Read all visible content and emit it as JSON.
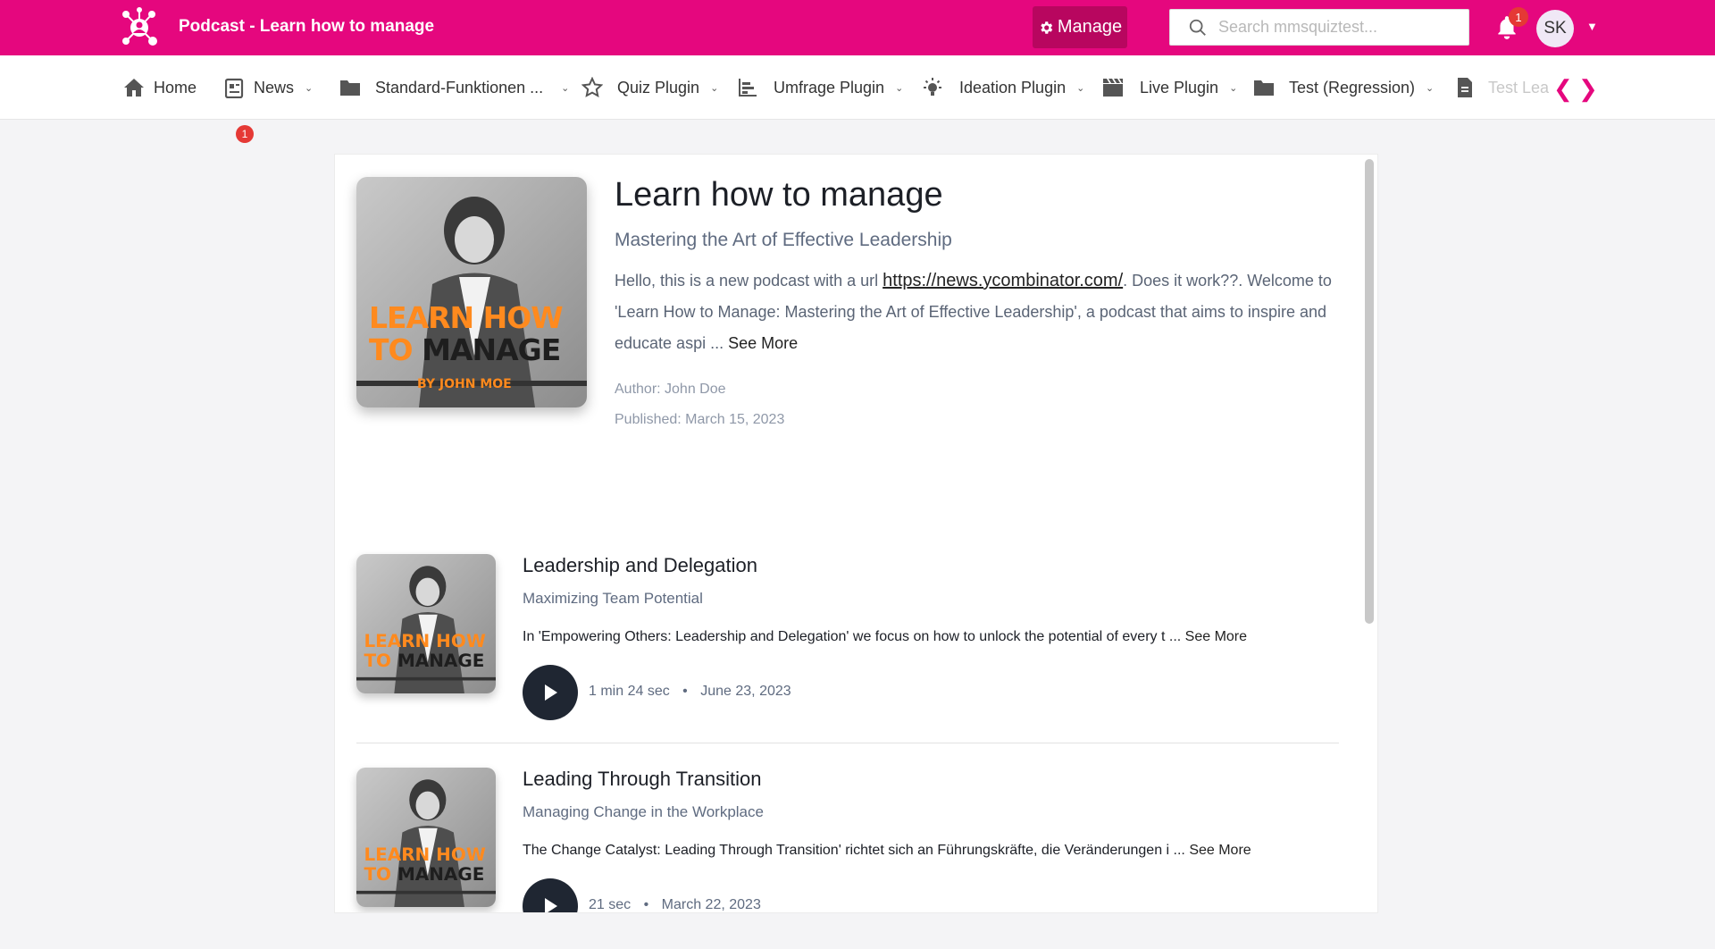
{
  "header": {
    "app_title": "Podcast - Learn how to manage",
    "manage_label": "Manage",
    "search_placeholder": "Search mmsquiztest...",
    "notifications_count": "1",
    "avatar_initials": "SK",
    "brand_color": "#e5077e"
  },
  "nav": {
    "items": [
      {
        "label": "Home",
        "icon": "home-icon"
      },
      {
        "label": "News",
        "icon": "news-icon",
        "badge": "1"
      },
      {
        "label": "Standard-Funktionen ...",
        "icon": "folder-icon"
      },
      {
        "label": "Quiz Plugin",
        "icon": "star-icon"
      },
      {
        "label": "Umfrage Plugin",
        "icon": "bar-chart-icon"
      },
      {
        "label": "Ideation Plugin",
        "icon": "lightbulb-icon"
      },
      {
        "label": "Live Plugin",
        "icon": "clapperboard-icon"
      },
      {
        "label": "Test (Regression)",
        "icon": "folder-icon"
      },
      {
        "label": "Test Lea",
        "icon": "document-icon"
      }
    ]
  },
  "podcast": {
    "cover_text_line1": "LEARN HOW",
    "cover_text_line2a": "TO",
    "cover_text_line2b": "MANAGE",
    "cover_byline": "BY JOHN MOE",
    "title": "Learn how to manage",
    "subtitle": "Mastering the Art of Effective Leadership",
    "description_before_link": "Hello, this is a new podcast with a url ",
    "description_link": "https://news.ycombinator.com/",
    "description_after_link": ". Does it work??. Welcome to 'Learn How to Manage: Mastering the Art of Effective Leadership', a podcast that aims to inspire and educate aspi ... ",
    "see_more": "See More",
    "author": "Author: John Doe",
    "published": "Published: March 15, 2023"
  },
  "episodes": [
    {
      "title": "Leadership and Delegation",
      "subtitle": "Maximizing Team Potential",
      "description": "In 'Empowering Others: Leadership and Delegation' we focus on how to unlock the potential of every t ... ",
      "see_more": "See More",
      "duration": "1 min 24 sec",
      "separator": "•",
      "date": "June 23, 2023"
    },
    {
      "title": "Leading Through Transition",
      "subtitle": "Managing Change in the Workplace",
      "description": "The Change Catalyst: Leading Through Transition' richtet sich an Führungskräfte, die Veränderungen i ... ",
      "see_more": "See More",
      "duration": "21 sec",
      "separator": "•",
      "date": "March 22, 2023"
    }
  ]
}
